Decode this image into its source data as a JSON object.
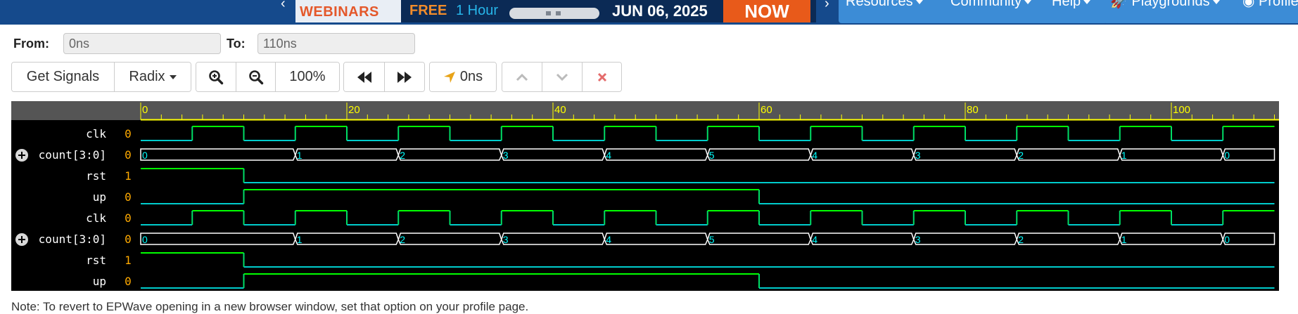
{
  "topbar": {
    "ad": {
      "brand_text": "WEBINARS",
      "free_label": "FREE",
      "duration": "1 Hour",
      "date": "JUN 06, 2025",
      "cta": "NOW"
    },
    "nav": [
      {
        "label": "Resources"
      },
      {
        "label": "Community"
      },
      {
        "label": "Help"
      },
      {
        "label": "Playgrounds"
      },
      {
        "label": "Profile"
      }
    ]
  },
  "range": {
    "from_label": "From:",
    "from_value": "0ns",
    "to_label": "To:",
    "to_value": "110ns"
  },
  "toolbar": {
    "get_signals": "Get Signals",
    "radix": "Radix",
    "zoom_level": "100%",
    "cursor_time": "0ns"
  },
  "waveform": {
    "ruler_labels": [
      "0",
      "20",
      "40",
      "60",
      "80",
      "100"
    ],
    "time_end_ns": 110,
    "signals": [
      {
        "name": "clk",
        "value": "0",
        "type": "bit",
        "waves": [
          [
            0,
            0
          ],
          [
            5,
            1
          ],
          [
            10,
            0
          ],
          [
            15,
            1
          ],
          [
            20,
            0
          ],
          [
            25,
            1
          ],
          [
            30,
            0
          ],
          [
            35,
            1
          ],
          [
            40,
            0
          ],
          [
            45,
            1
          ],
          [
            50,
            0
          ],
          [
            55,
            1
          ],
          [
            60,
            0
          ],
          [
            65,
            1
          ],
          [
            70,
            0
          ],
          [
            75,
            1
          ],
          [
            80,
            0
          ],
          [
            85,
            1
          ],
          [
            90,
            0
          ],
          [
            95,
            1
          ],
          [
            100,
            0
          ],
          [
            105,
            1
          ]
        ]
      },
      {
        "name": "count[3:0]",
        "value": "0",
        "type": "bus",
        "expandable": true,
        "waves": [
          [
            0,
            "0"
          ],
          [
            15,
            "1"
          ],
          [
            25,
            "2"
          ],
          [
            35,
            "3"
          ],
          [
            45,
            "4"
          ],
          [
            55,
            "5"
          ],
          [
            65,
            "4"
          ],
          [
            75,
            "3"
          ],
          [
            85,
            "2"
          ],
          [
            95,
            "1"
          ],
          [
            105,
            "0"
          ]
        ]
      },
      {
        "name": "rst",
        "value": "1",
        "type": "bit",
        "waves": [
          [
            0,
            1
          ],
          [
            10,
            0
          ]
        ]
      },
      {
        "name": "up",
        "value": "0",
        "type": "bit",
        "waves": [
          [
            0,
            0
          ],
          [
            10,
            1
          ],
          [
            60,
            0
          ]
        ]
      },
      {
        "name": "clk",
        "value": "0",
        "type": "bit",
        "waves": [
          [
            0,
            0
          ],
          [
            5,
            1
          ],
          [
            10,
            0
          ],
          [
            15,
            1
          ],
          [
            20,
            0
          ],
          [
            25,
            1
          ],
          [
            30,
            0
          ],
          [
            35,
            1
          ],
          [
            40,
            0
          ],
          [
            45,
            1
          ],
          [
            50,
            0
          ],
          [
            55,
            1
          ],
          [
            60,
            0
          ],
          [
            65,
            1
          ],
          [
            70,
            0
          ],
          [
            75,
            1
          ],
          [
            80,
            0
          ],
          [
            85,
            1
          ],
          [
            90,
            0
          ],
          [
            95,
            1
          ],
          [
            100,
            0
          ],
          [
            105,
            1
          ]
        ]
      },
      {
        "name": "count[3:0]",
        "value": "0",
        "type": "bus",
        "expandable": true,
        "waves": [
          [
            0,
            "0"
          ],
          [
            15,
            "1"
          ],
          [
            25,
            "2"
          ],
          [
            35,
            "3"
          ],
          [
            45,
            "4"
          ],
          [
            55,
            "5"
          ],
          [
            65,
            "4"
          ],
          [
            75,
            "3"
          ],
          [
            85,
            "2"
          ],
          [
            95,
            "1"
          ],
          [
            105,
            "0"
          ]
        ]
      },
      {
        "name": "rst",
        "value": "1",
        "type": "bit",
        "waves": [
          [
            0,
            1
          ],
          [
            10,
            0
          ]
        ]
      },
      {
        "name": "up",
        "value": "0",
        "type": "bit",
        "waves": [
          [
            0,
            0
          ],
          [
            10,
            1
          ],
          [
            60,
            0
          ]
        ]
      }
    ]
  },
  "note": "Note: To revert to EPWave opening in a new browser window, set that option on your profile page."
}
